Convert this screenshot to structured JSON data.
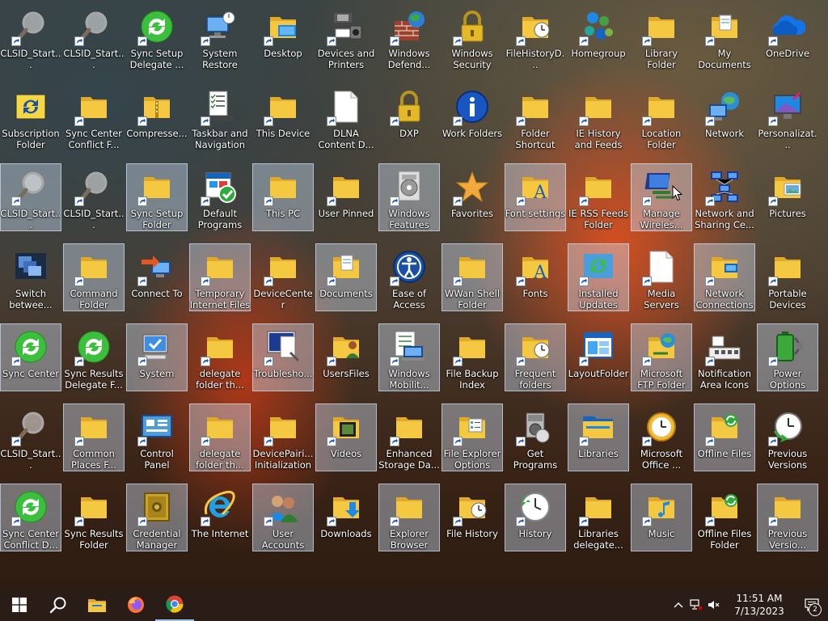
{
  "desktop": {
    "icons": [
      [
        {
          "label": "CLSID_Start...",
          "icon": "magnifier",
          "selected": false,
          "shortcut": true
        },
        {
          "label": "CLSID_Start...",
          "icon": "magnifier",
          "selected": false,
          "shortcut": true
        },
        {
          "label": "Sync Setup Delegate ...",
          "icon": "sync",
          "selected": false,
          "shortcut": true
        },
        {
          "label": "System Restore",
          "icon": "computer",
          "selected": false,
          "shortcut": true
        },
        {
          "label": "Desktop",
          "icon": "folder-blue",
          "selected": false,
          "shortcut": true
        },
        {
          "label": "Devices and Printers",
          "icon": "printer",
          "selected": false,
          "shortcut": true
        },
        {
          "label": "Windows Defend...",
          "icon": "firewall",
          "selected": false,
          "shortcut": true
        },
        {
          "label": "Windows Security",
          "icon": "lock",
          "selected": false,
          "shortcut": true
        },
        {
          "label": "FileHistoryD...",
          "icon": "folder-clock",
          "selected": false,
          "shortcut": true
        },
        {
          "label": "Homegroup",
          "icon": "homegroup",
          "selected": false,
          "shortcut": true
        },
        {
          "label": "Library Folder",
          "icon": "folder",
          "selected": false,
          "shortcut": true
        },
        {
          "label": "My Documents",
          "icon": "folder-docs",
          "selected": false,
          "shortcut": true
        },
        {
          "label": "OneDrive",
          "icon": "cloud",
          "selected": false,
          "shortcut": true
        }
      ],
      [
        {
          "label": "Subscription Folder",
          "icon": "sync-yellow",
          "selected": false,
          "shortcut": false
        },
        {
          "label": "Sync Center Conflict F...",
          "icon": "folder",
          "selected": false,
          "shortcut": true
        },
        {
          "label": "Compresse...",
          "icon": "folder-zip",
          "selected": false,
          "shortcut": true
        },
        {
          "label": "Taskbar and Navigation",
          "icon": "checklist",
          "selected": false,
          "shortcut": true
        },
        {
          "label": "This Device",
          "icon": "folder",
          "selected": false,
          "shortcut": true
        },
        {
          "label": "DLNA Content D...",
          "icon": "document",
          "selected": false,
          "shortcut": true
        },
        {
          "label": "DXP",
          "icon": "lock",
          "selected": false,
          "shortcut": true
        },
        {
          "label": "Work Folders",
          "icon": "info",
          "selected": false,
          "shortcut": true
        },
        {
          "label": "Folder Shortcut",
          "icon": "folder",
          "selected": false,
          "shortcut": true
        },
        {
          "label": "IE History and Feeds Shell ...",
          "icon": "folder",
          "selected": false,
          "shortcut": true
        },
        {
          "label": "Location Folder",
          "icon": "folder",
          "selected": false,
          "shortcut": true
        },
        {
          "label": "Network",
          "icon": "network",
          "selected": false,
          "shortcut": true
        },
        {
          "label": "Personalizat...",
          "icon": "monitor",
          "selected": false,
          "shortcut": true
        }
      ],
      [
        {
          "label": "CLSID_Start...",
          "icon": "magnifier",
          "selected": true,
          "shortcut": true
        },
        {
          "label": "CLSID_Start...",
          "icon": "magnifier",
          "selected": false,
          "shortcut": true
        },
        {
          "label": "Sync Setup Folder",
          "icon": "folder",
          "selected": true,
          "shortcut": true
        },
        {
          "label": "Default Programs",
          "icon": "default-programs",
          "selected": false,
          "shortcut": true
        },
        {
          "label": "This PC",
          "icon": "folder",
          "selected": true,
          "shortcut": true
        },
        {
          "label": "User Pinned",
          "icon": "folder",
          "selected": false,
          "shortcut": true
        },
        {
          "label": "Windows Features",
          "icon": "features",
          "selected": true,
          "shortcut": true
        },
        {
          "label": "Favorites",
          "icon": "star",
          "selected": false,
          "shortcut": true
        },
        {
          "label": "Font settings",
          "icon": "font",
          "selected": true,
          "shortcut": true
        },
        {
          "label": "IE RSS Feeds Folder",
          "icon": "folder",
          "selected": false,
          "shortcut": true
        },
        {
          "label": "Manage Wireles...",
          "icon": "wireless",
          "selected": true,
          "shortcut": true
        },
        {
          "label": "Network and Sharing Ce...",
          "icon": "network-sharing",
          "selected": false,
          "shortcut": true
        },
        {
          "label": "Pictures",
          "icon": "folder-pictures",
          "selected": false,
          "shortcut": true
        }
      ],
      [
        {
          "label": "Switch betwee...",
          "icon": "switch-windows",
          "selected": false,
          "shortcut": false
        },
        {
          "label": "Command Folder",
          "icon": "folder",
          "selected": true,
          "shortcut": true
        },
        {
          "label": "Connect To",
          "icon": "connect",
          "selected": false,
          "shortcut": true
        },
        {
          "label": "Temporary Internet Files",
          "icon": "folder",
          "selected": true,
          "shortcut": true
        },
        {
          "label": "DeviceCenter Initialization",
          "icon": "folder",
          "selected": false,
          "shortcut": true
        },
        {
          "label": "Documents",
          "icon": "folder-docs",
          "selected": true,
          "shortcut": true
        },
        {
          "label": "Ease of Access Center",
          "icon": "ease-access",
          "selected": false,
          "shortcut": true
        },
        {
          "label": "WWan Shell Folder",
          "icon": "folder",
          "selected": true,
          "shortcut": true
        },
        {
          "label": "Fonts",
          "icon": "font",
          "selected": false,
          "shortcut": true
        },
        {
          "label": "Installed Updates",
          "icon": "updates",
          "selected": true,
          "shortcut": true
        },
        {
          "label": "Media Servers",
          "icon": "document",
          "selected": false,
          "shortcut": true
        },
        {
          "label": "Network Connections",
          "icon": "network-folder",
          "selected": true,
          "shortcut": true
        },
        {
          "label": "Portable Devices",
          "icon": "folder",
          "selected": false,
          "shortcut": true
        }
      ],
      [
        {
          "label": "Sync Center",
          "icon": "sync",
          "selected": true,
          "shortcut": true
        },
        {
          "label": "Sync Results Delegate F...",
          "icon": "sync",
          "selected": false,
          "shortcut": true
        },
        {
          "label": "System",
          "icon": "computer-check",
          "selected": true,
          "shortcut": true
        },
        {
          "label": "delegate folder th...",
          "icon": "folder",
          "selected": false,
          "shortcut": true
        },
        {
          "label": "Troublesho...",
          "icon": "troubleshoot",
          "selected": true,
          "shortcut": true
        },
        {
          "label": "UsersFiles",
          "icon": "user-folder",
          "selected": false,
          "shortcut": true
        },
        {
          "label": "Windows Mobilit...",
          "icon": "mobility",
          "selected": true,
          "shortcut": true
        },
        {
          "label": "File Backup Index",
          "icon": "folder",
          "selected": false,
          "shortcut": true
        },
        {
          "label": "Frequent folders",
          "icon": "folder-clock",
          "selected": true,
          "shortcut": true
        },
        {
          "label": "LayoutFolder",
          "icon": "layout",
          "selected": false,
          "shortcut": true
        },
        {
          "label": "Microsoft FTP Folder",
          "icon": "ftp",
          "selected": true,
          "shortcut": true
        },
        {
          "label": "Notification Area Icons",
          "icon": "notification-area",
          "selected": false,
          "shortcut": true
        },
        {
          "label": "Power Options",
          "icon": "battery",
          "selected": true,
          "shortcut": true
        }
      ],
      [
        {
          "label": "CLSID_Start...",
          "icon": "magnifier",
          "selected": false,
          "shortcut": true
        },
        {
          "label": "Common Places F...",
          "icon": "folder",
          "selected": true,
          "shortcut": true
        },
        {
          "label": "Control Panel",
          "icon": "control-panel",
          "selected": false,
          "shortcut": true
        },
        {
          "label": "delegate folder th...",
          "icon": "folder",
          "selected": true,
          "shortcut": true
        },
        {
          "label": "DevicePairi... Initialization",
          "icon": "folder",
          "selected": false,
          "shortcut": true
        },
        {
          "label": "Videos",
          "icon": "folder-video",
          "selected": true,
          "shortcut": true
        },
        {
          "label": "Enhanced Storage Da...",
          "icon": "folder",
          "selected": false,
          "shortcut": true
        },
        {
          "label": "File Explorer Options",
          "icon": "folder-options",
          "selected": true,
          "shortcut": true
        },
        {
          "label": "Get Programs",
          "icon": "get-programs",
          "selected": false,
          "shortcut": true
        },
        {
          "label": "Libraries",
          "icon": "libraries",
          "selected": true,
          "shortcut": true
        },
        {
          "label": "Microsoft Office ...",
          "icon": "office-clock",
          "selected": false,
          "shortcut": true
        },
        {
          "label": "Offline Files",
          "icon": "folder-sync",
          "selected": true,
          "shortcut": true
        },
        {
          "label": "Previous Versions",
          "icon": "clock-green",
          "selected": false,
          "shortcut": true
        }
      ],
      [
        {
          "label": "Sync Center Conflict D...",
          "icon": "sync",
          "selected": true,
          "shortcut": true
        },
        {
          "label": "Sync Results Folder",
          "icon": "folder",
          "selected": false,
          "shortcut": true
        },
        {
          "label": "Credential Manager",
          "icon": "vault",
          "selected": true,
          "shortcut": true
        },
        {
          "label": "The Internet",
          "icon": "ie",
          "selected": false,
          "shortcut": true
        },
        {
          "label": "User Accounts",
          "icon": "users",
          "selected": true,
          "shortcut": true
        },
        {
          "label": "Downloads",
          "icon": "folder-download",
          "selected": false,
          "shortcut": true
        },
        {
          "label": "Explorer Browser Res...",
          "icon": "folder",
          "selected": true,
          "shortcut": true
        },
        {
          "label": "File History",
          "icon": "folder-clock",
          "selected": false,
          "shortcut": true
        },
        {
          "label": "History",
          "icon": "history",
          "selected": true,
          "shortcut": true
        },
        {
          "label": "Libraries delegate...",
          "icon": "folder",
          "selected": false,
          "shortcut": true
        },
        {
          "label": "Music",
          "icon": "folder-music",
          "selected": true,
          "shortcut": true
        },
        {
          "label": "Offline Files Folder",
          "icon": "folder-sync",
          "selected": false,
          "shortcut": true
        },
        {
          "label": "Previous Versio...",
          "icon": "folder",
          "selected": true,
          "shortcut": true
        }
      ]
    ]
  },
  "taskbar": {
    "start_icon": "windows-logo-icon",
    "search_icon": "search-icon",
    "pinned": [
      {
        "name": "file-explorer",
        "icon": "folder-icon",
        "active": false
      },
      {
        "name": "firefox",
        "icon": "firefox-icon",
        "active": false
      },
      {
        "name": "chrome",
        "icon": "chrome-icon",
        "active": true
      }
    ],
    "clock": {
      "time": "11:51 AM",
      "date": "7/13/2023"
    },
    "notifications_count": "2"
  },
  "colors": {
    "folder": "#f5c842",
    "folder_dark": "#e0a92a",
    "selection": "#cfe2f5",
    "taskbar": "#2a1c16"
  }
}
